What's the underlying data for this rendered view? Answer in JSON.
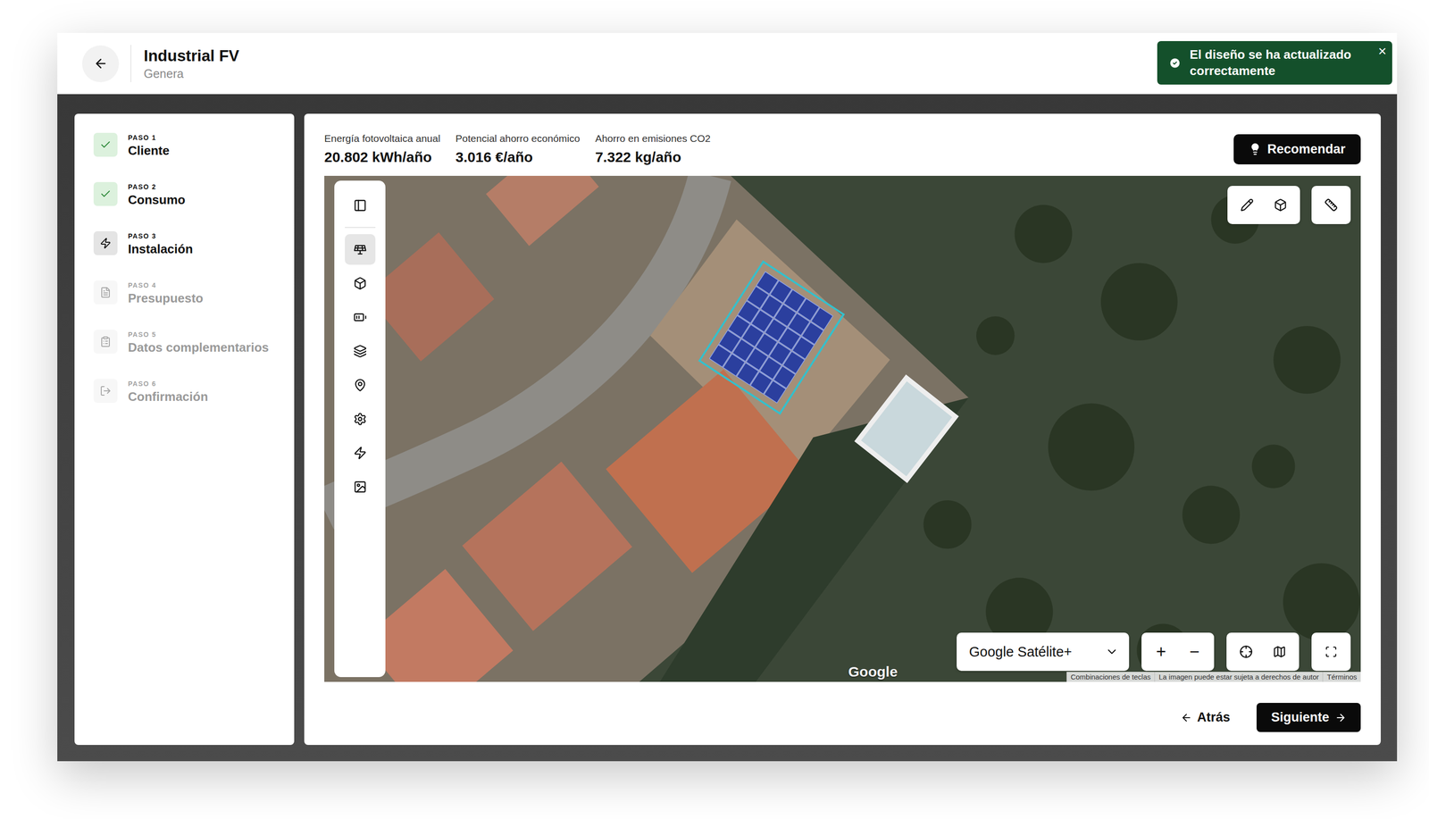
{
  "header": {
    "title": "Industrial FV",
    "subtitle": "Genera"
  },
  "toast": {
    "message": "El diseño se ha actualizado correctamente",
    "close": "×"
  },
  "steps": [
    {
      "label": "PASO 1",
      "name": "Cliente",
      "completed": true,
      "current": false
    },
    {
      "label": "PASO 2",
      "name": "Consumo",
      "completed": true,
      "current": false
    },
    {
      "label": "PASO 3",
      "name": "Instalación",
      "completed": false,
      "current": true
    },
    {
      "label": "PASO 4",
      "name": "Presupuesto",
      "completed": false,
      "current": false
    },
    {
      "label": "PASO 5",
      "name": "Datos complementarios",
      "completed": false,
      "current": false
    },
    {
      "label": "PASO 6",
      "name": "Confirmación",
      "completed": false,
      "current": false
    }
  ],
  "stats": [
    {
      "label": "Energía fotovoltaica anual",
      "value": "20.802 kWh/año"
    },
    {
      "label": "Potencial ahorro económico",
      "value": "3.016 €/año"
    },
    {
      "label": "Ahorro en emisiones CO2",
      "value": "7.322 kg/año"
    }
  ],
  "recommend_button": "Recomendar",
  "map": {
    "tools": [
      {
        "selected": false
      },
      {
        "selected": true
      },
      {
        "selected": false
      },
      {
        "selected": false
      },
      {
        "selected": false
      },
      {
        "selected": false
      },
      {
        "selected": false
      },
      {
        "selected": false
      },
      {
        "selected": false
      }
    ],
    "layer_select": "Google Satélite+",
    "zoom_in": "+",
    "zoom_out": "−",
    "logo": "Google",
    "attribution": [
      "Combinaciones de teclas",
      "La imagen puede estar sujeta a derechos de autor",
      "Términos"
    ]
  },
  "footer": {
    "back": "Atrás",
    "next": "Siguiente"
  }
}
